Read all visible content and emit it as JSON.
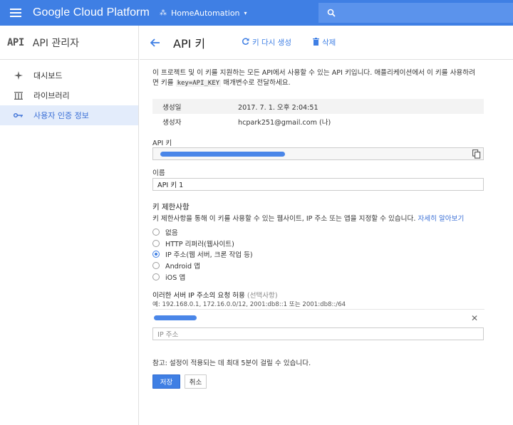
{
  "topbar": {
    "logo": "Google Cloud Platform",
    "project_name": "HomeAutomation",
    "project_caret": "▾"
  },
  "sidebar": {
    "logo_text": "API",
    "title": "API 관리자",
    "items": [
      {
        "label": "대시보드",
        "icon": "dashboard-icon",
        "active": false
      },
      {
        "label": "라이브러리",
        "icon": "library-icon",
        "active": false
      },
      {
        "label": "사용자 인증 정보",
        "icon": "key-icon",
        "active": true
      }
    ]
  },
  "header": {
    "title": "API 키",
    "regenerate_label": "키 다시 생성",
    "delete_label": "삭제"
  },
  "main": {
    "description_1": "이 프로젝트 및 이 키를 지원하는 모든 API에서 사용할 수 있는 API 키입니다. 애플리케이션에서 이 키를 사용하려",
    "description_2a": "면 키를 ",
    "description_code": "key=API_KEY",
    "description_2b": " 매개변수로 전달하세요.",
    "meta": [
      {
        "key": "생성일",
        "value": "2017. 7. 1. 오후 2:04:51"
      },
      {
        "key": "생성자",
        "value": "hcpark251@gmail.com (나)"
      }
    ],
    "api_key_label": "API 키",
    "name_label": "이름",
    "name_value": "API 키 1",
    "restriction_title": "키 제한사항",
    "restriction_desc": "키 제한사항을 통해 이 키를 사용할 수 있는 웹사이트, IP 주소 또는 앱을 지정할 수 있습니다. ",
    "learn_more": "자세히 알아보기",
    "options": [
      {
        "label": "없음",
        "checked": false
      },
      {
        "label": "HTTP 리퍼러(웹사이트)",
        "checked": false
      },
      {
        "label": "IP 주소(웹 서버, 크론 작업 등)",
        "checked": true
      },
      {
        "label": "Android 앱",
        "checked": false
      },
      {
        "label": "iOS 앱",
        "checked": false
      }
    ],
    "ip_title": "이러한 서버 IP 주소의 요청 허용",
    "ip_optional": " (선택사항)",
    "ip_example": "예: 192.168.0.1, 172.16.0.0/12, 2001:db8::1 또는 2001:db8::/64",
    "ip_placeholder": "IP 주소",
    "note": "참고: 설정이 적용되는 데 최대 5분이 걸릴 수 있습니다.",
    "save_label": "저장",
    "cancel_label": "취소"
  },
  "colors": {
    "accent": "#3f7fe4",
    "active_bg": "#e3ecfb"
  }
}
